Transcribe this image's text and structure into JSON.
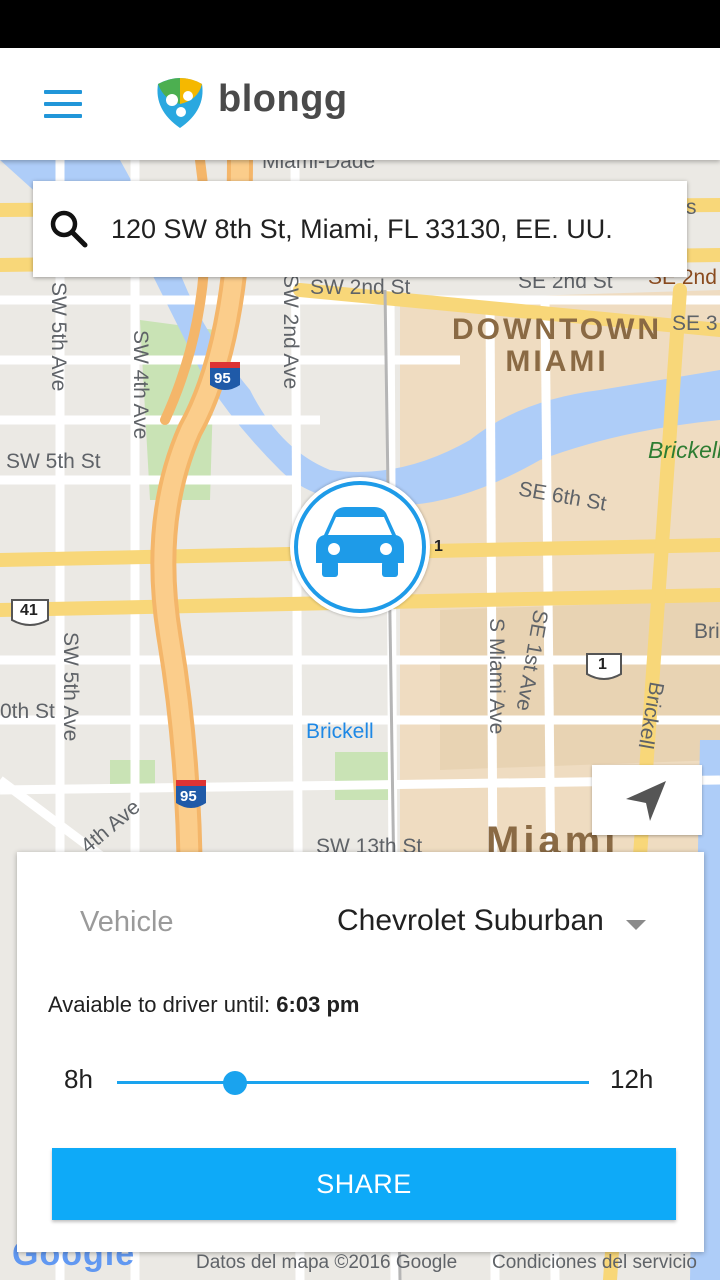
{
  "app": {
    "brand": "blongg"
  },
  "search": {
    "value": "120 SW 8th St, Miami, FL 33130, EE. UU."
  },
  "map": {
    "labels": {
      "miami_dade": "Miami-Dade",
      "sw_2nd_st": "SW 2nd St",
      "se_2nd_st": "SE 2nd St",
      "se_2nd": "SE 2nd",
      "se_3": "SE 3",
      "sw_5th_ave_top": "SW 5th Ave",
      "sw_4th_ave": "SW 4th Ave",
      "sw_2nd_ave": "SW 2nd Ave",
      "sw_5th_st": "SW 5th St",
      "se_6th_st": "SE 6th St",
      "sw_5th_ave_bottom": "SW 5th Ave",
      "s_miami_ave": "S Miami Ave",
      "se_1st_ave": "SE 1st Ave",
      "brickell_ave": "Brickell",
      "brickell_e": "Bri",
      "sw_10th_st": "0th St",
      "sw_13th_st": "SW 13th St",
      "sw_4th_ave_bottom": "4th Ave",
      "s_edge": "s"
    },
    "district": "DOWNTOWN\nMIAMI",
    "area_label": "Brickell",
    "station": "Brickell",
    "miami_big": "Miami",
    "shields": {
      "i95_top": "95",
      "i95_bottom": "95",
      "us41": "41",
      "us1_a": "1",
      "us1_b": "1"
    },
    "attribution": "Datos del mapa ©2016 Google",
    "terms": "Condiciones del servicio",
    "google": "Google"
  },
  "panel": {
    "vehicle_label": "Vehicle",
    "vehicle_value": "Chevrolet Suburban",
    "availability_prefix": "Avaiable to driver until:",
    "availability_time": "6:03 pm",
    "slider_min": "8h",
    "slider_max": "12h",
    "slider_fraction": 0.25,
    "share_label": "SHARE"
  },
  "colors": {
    "accent": "#0eaaf8",
    "marker": "#1e9be8",
    "menu": "#2196d9"
  }
}
